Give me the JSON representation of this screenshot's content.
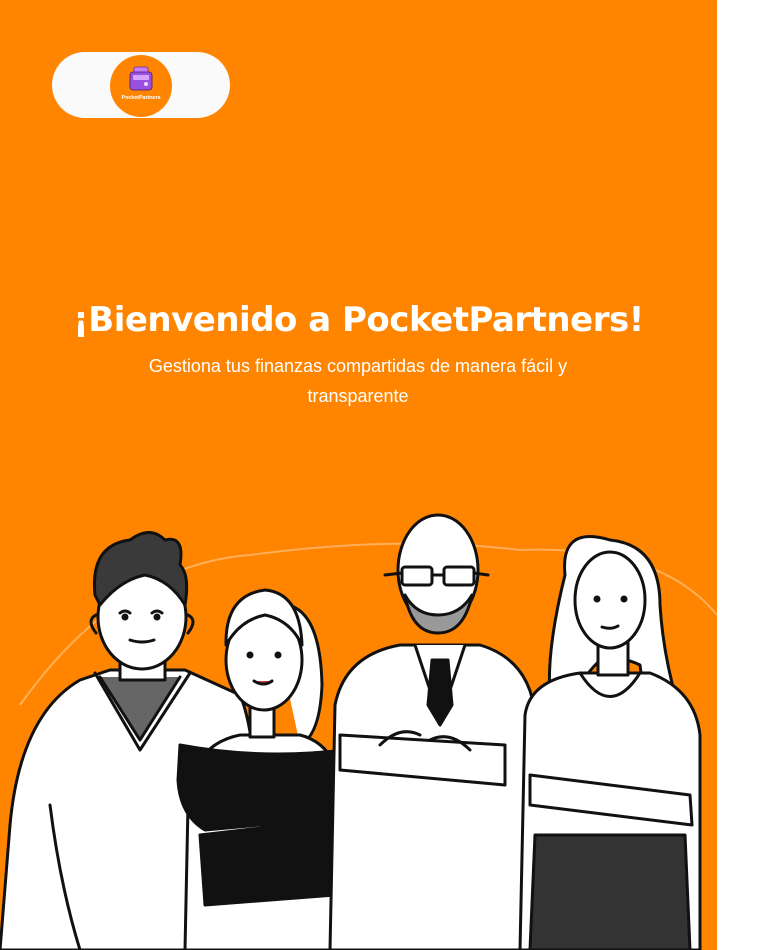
{
  "brand": {
    "logo_text": "PocketPartners",
    "accent_color": "#FF8500",
    "logo_icon": "wallet-icon"
  },
  "welcome": {
    "title": "¡Bienvenido a PocketPartners!",
    "subtitle": "Gestiona tus finanzas compartidas de manera fácil y transparente"
  },
  "illustration": {
    "name": "group-of-people-illustration"
  }
}
